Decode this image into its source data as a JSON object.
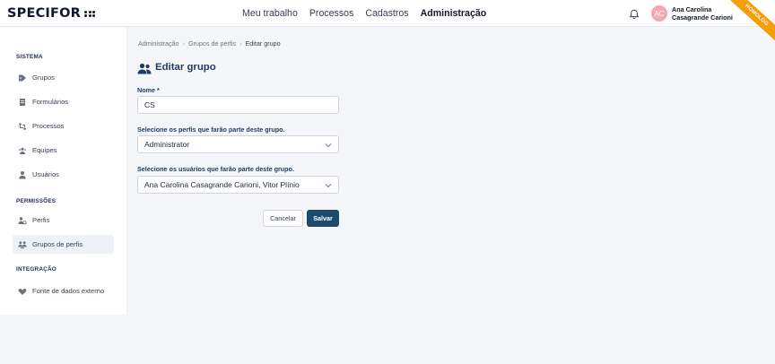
{
  "app": {
    "logo_text": "SPECIFOR"
  },
  "nav": {
    "items": [
      {
        "label": "Meu trabalho",
        "active": false
      },
      {
        "label": "Processos",
        "active": false
      },
      {
        "label": "Cadastros",
        "active": false
      },
      {
        "label": "Administração",
        "active": true
      }
    ]
  },
  "user": {
    "initials": "AC",
    "name": "Ana Carolina Casagrande Carioni"
  },
  "env_ribbon": "HOMOLOG",
  "sidebar": {
    "sections": [
      {
        "title": "SISTEMA",
        "items": [
          {
            "label": "Grupos",
            "icon": "tag-icon"
          },
          {
            "label": "Formulários",
            "icon": "document-icon"
          },
          {
            "label": "Processos",
            "icon": "process-icon"
          },
          {
            "label": "Equipes",
            "icon": "team-icon"
          },
          {
            "label": "Usuários",
            "icon": "user-icon"
          }
        ]
      },
      {
        "title": "PERMISSÕES",
        "items": [
          {
            "label": "Perfis",
            "icon": "profile-icon"
          },
          {
            "label": "Grupos de perfis",
            "icon": "profile-group-icon",
            "active": true
          }
        ]
      },
      {
        "title": "INTEGRAÇÃO",
        "items": [
          {
            "label": "Fonte de dados externo",
            "icon": "heart-icon"
          }
        ]
      }
    ]
  },
  "breadcrumb": {
    "items": [
      "Administração",
      "Grupos de perfis",
      "Editar grupo"
    ]
  },
  "page": {
    "title": "Editar grupo"
  },
  "form": {
    "name_label": "Nome *",
    "name_value": "CS",
    "profiles_label": "Selecione os perfis que farão parte deste grupo.",
    "profiles_value": "Administrator",
    "users_label": "Selecione os usuários que farão parte deste grupo.",
    "users_value": "Ana Carolina Casagrande Carioni, Vitor Plínio",
    "cancel_label": "Cancelar",
    "save_label": "Salvar"
  },
  "colors": {
    "primary": "#1e4a6d",
    "title": "#1e3a5f",
    "ribbon": "#f59e0b",
    "avatar": "#f3a7b6"
  }
}
